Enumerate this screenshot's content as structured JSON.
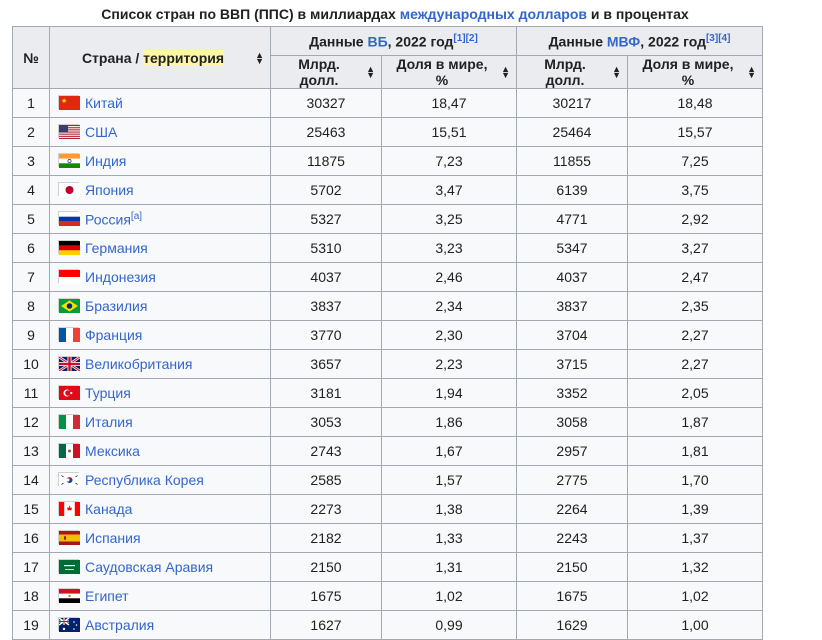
{
  "caption": {
    "prefix": "Список стран по ВВП (ППС) в миллиардах ",
    "link": "международных долларов",
    "suffix": " и в процентах"
  },
  "header": {
    "num": "№",
    "country_prefix": "Страна / ",
    "country_highlight": "территория",
    "wb_prefix": "Данные ",
    "wb_link": "ВБ",
    "wb_suffix": ", 2022 год",
    "wb_refs": "[1][2]",
    "imf_prefix": "Данные ",
    "imf_link": "МВФ",
    "imf_suffix": ", 2022 год",
    "imf_refs": "[3][4]",
    "col_bln": "Млрд. долл.",
    "col_share": "Доля в мире, %",
    "col_bln2": "Млрд. долл.",
    "col_share2": "Доля в мире, %"
  },
  "rows": [
    {
      "n": "1",
      "country": "Китай",
      "flag": "china-flag",
      "sup": "",
      "wb_bln": "30327",
      "wb_share": "18,47",
      "imf_bln": "30217",
      "imf_share": "18,48"
    },
    {
      "n": "2",
      "country": "США",
      "flag": "usa-flag",
      "sup": "",
      "wb_bln": "25463",
      "wb_share": "15,51",
      "imf_bln": "25464",
      "imf_share": "15,57"
    },
    {
      "n": "3",
      "country": "Индия",
      "flag": "india-flag",
      "sup": "",
      "wb_bln": "11875",
      "wb_share": "7,23",
      "imf_bln": "11855",
      "imf_share": "7,25"
    },
    {
      "n": "4",
      "country": "Япония",
      "flag": "japan-flag",
      "sup": "",
      "wb_bln": "5702",
      "wb_share": "3,47",
      "imf_bln": "6139",
      "imf_share": "3,75"
    },
    {
      "n": "5",
      "country": "Россия",
      "flag": "russia-flag",
      "sup": "[a]",
      "wb_bln": "5327",
      "wb_share": "3,25",
      "imf_bln": "4771",
      "imf_share": "2,92"
    },
    {
      "n": "6",
      "country": "Германия",
      "flag": "germany-flag",
      "sup": "",
      "wb_bln": "5310",
      "wb_share": "3,23",
      "imf_bln": "5347",
      "imf_share": "3,27"
    },
    {
      "n": "7",
      "country": "Индонезия",
      "flag": "indonesia-flag",
      "sup": "",
      "wb_bln": "4037",
      "wb_share": "2,46",
      "imf_bln": "4037",
      "imf_share": "2,47"
    },
    {
      "n": "8",
      "country": "Бразилия",
      "flag": "brazil-flag",
      "sup": "",
      "wb_bln": "3837",
      "wb_share": "2,34",
      "imf_bln": "3837",
      "imf_share": "2,35"
    },
    {
      "n": "9",
      "country": "Франция",
      "flag": "france-flag",
      "sup": "",
      "wb_bln": "3770",
      "wb_share": "2,30",
      "imf_bln": "3704",
      "imf_share": "2,27"
    },
    {
      "n": "10",
      "country": "Великобритания",
      "flag": "uk-flag",
      "sup": "",
      "wb_bln": "3657",
      "wb_share": "2,23",
      "imf_bln": "3715",
      "imf_share": "2,27"
    },
    {
      "n": "11",
      "country": "Турция",
      "flag": "turkey-flag",
      "sup": "",
      "wb_bln": "3181",
      "wb_share": "1,94",
      "imf_bln": "3352",
      "imf_share": "2,05"
    },
    {
      "n": "12",
      "country": "Италия",
      "flag": "italy-flag",
      "sup": "",
      "wb_bln": "3053",
      "wb_share": "1,86",
      "imf_bln": "3058",
      "imf_share": "1,87"
    },
    {
      "n": "13",
      "country": "Мексика",
      "flag": "mexico-flag",
      "sup": "",
      "wb_bln": "2743",
      "wb_share": "1,67",
      "imf_bln": "2957",
      "imf_share": "1,81"
    },
    {
      "n": "14",
      "country": "Республика Корея",
      "flag": "korea-flag",
      "sup": "",
      "wb_bln": "2585",
      "wb_share": "1,57",
      "imf_bln": "2775",
      "imf_share": "1,70"
    },
    {
      "n": "15",
      "country": "Канада",
      "flag": "canada-flag",
      "sup": "",
      "wb_bln": "2273",
      "wb_share": "1,38",
      "imf_bln": "2264",
      "imf_share": "1,39"
    },
    {
      "n": "16",
      "country": "Испания",
      "flag": "spain-flag",
      "sup": "",
      "wb_bln": "2182",
      "wb_share": "1,33",
      "imf_bln": "2243",
      "imf_share": "1,37"
    },
    {
      "n": "17",
      "country": "Саудовская Аравия",
      "flag": "saudi-arabia-flag",
      "sup": "",
      "wb_bln": "2150",
      "wb_share": "1,31",
      "imf_bln": "2150",
      "imf_share": "1,32"
    },
    {
      "n": "18",
      "country": "Египет",
      "flag": "egypt-flag",
      "sup": "",
      "wb_bln": "1675",
      "wb_share": "1,02",
      "imf_bln": "1675",
      "imf_share": "1,02"
    },
    {
      "n": "19",
      "country": "Австралия",
      "flag": "australia-flag",
      "sup": "",
      "wb_bln": "1627",
      "wb_share": "0,99",
      "imf_bln": "1629",
      "imf_share": "1,00"
    }
  ]
}
